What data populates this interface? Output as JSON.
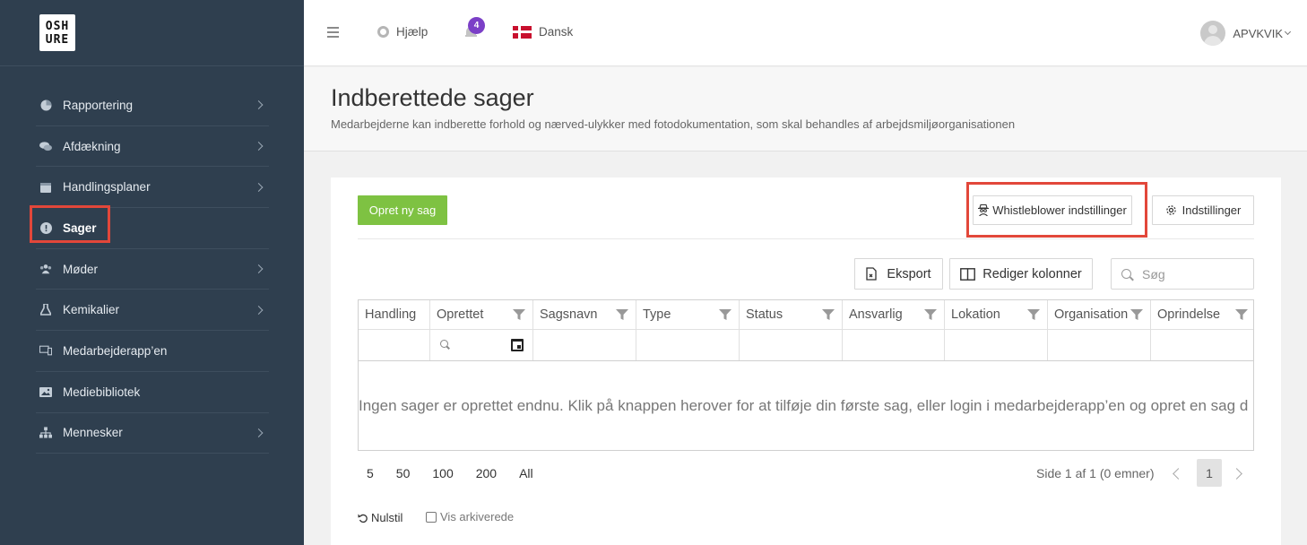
{
  "logo": {
    "line1": "OSH",
    "line2": "URE"
  },
  "sidebar": {
    "items": [
      {
        "label": "Rapportering",
        "icon": "pie-chart-icon",
        "has_submenu": true
      },
      {
        "label": "Afdækning",
        "icon": "chat-bubbles-icon",
        "has_submenu": true
      },
      {
        "label": "Handlingsplaner",
        "icon": "calendar-icon",
        "has_submenu": true
      },
      {
        "label": "Sager",
        "icon": "alert-circle-icon",
        "has_submenu": false,
        "active": true
      },
      {
        "label": "Møder",
        "icon": "users-icon",
        "has_submenu": true
      },
      {
        "label": "Kemikalier",
        "icon": "flask-icon",
        "has_submenu": true
      },
      {
        "label": "Medarbejderapp’en",
        "icon": "devices-icon",
        "has_submenu": false
      },
      {
        "label": "Mediebibliotek",
        "icon": "image-icon",
        "has_submenu": false
      },
      {
        "label": "Mennesker",
        "icon": "org-chart-icon",
        "has_submenu": true
      }
    ]
  },
  "topbar": {
    "help_label": "Hjælp",
    "notification_count": "4",
    "language_label": "Dansk",
    "user_name": "APVKVIK"
  },
  "header": {
    "title": "Indberettede sager",
    "description": "Medarbejderne kan indberette forhold og nærved-ulykker med fotodokumentation, som skal behandles af arbejdsmiljøorganisationen"
  },
  "toolbar": {
    "create_label": "Opret ny sag",
    "whistleblower_label": "Whistleblower indstillinger",
    "settings_label": "Indstillinger",
    "export_label": "Eksport",
    "edit_columns_label": "Rediger kolonner",
    "search_placeholder": "Søg"
  },
  "table": {
    "columns": [
      "Handling",
      "Oprettet",
      "Sagsnavn",
      "Type",
      "Status",
      "Ansvarlig",
      "Lokation",
      "Organisation",
      "Oprindelse"
    ],
    "empty_message": "Ingen sager er oprettet endnu. Klik på knappen herover for at tilføje din første sag, eller login i medarbejderapp’en og opret en sag d"
  },
  "pager": {
    "sizes": [
      "5",
      "50",
      "100",
      "200",
      "All"
    ],
    "info": "Side 1 af 1 (0 emner)",
    "current_page": "1"
  },
  "footer": {
    "reset_label": "Nulstil",
    "archive_label": "Vis arkiverede"
  },
  "colors": {
    "sidebar_bg": "#2f3f4f",
    "primary_green": "#7ec242",
    "badge_purple": "#7b3fc7",
    "highlight_red": "#e2473a"
  }
}
